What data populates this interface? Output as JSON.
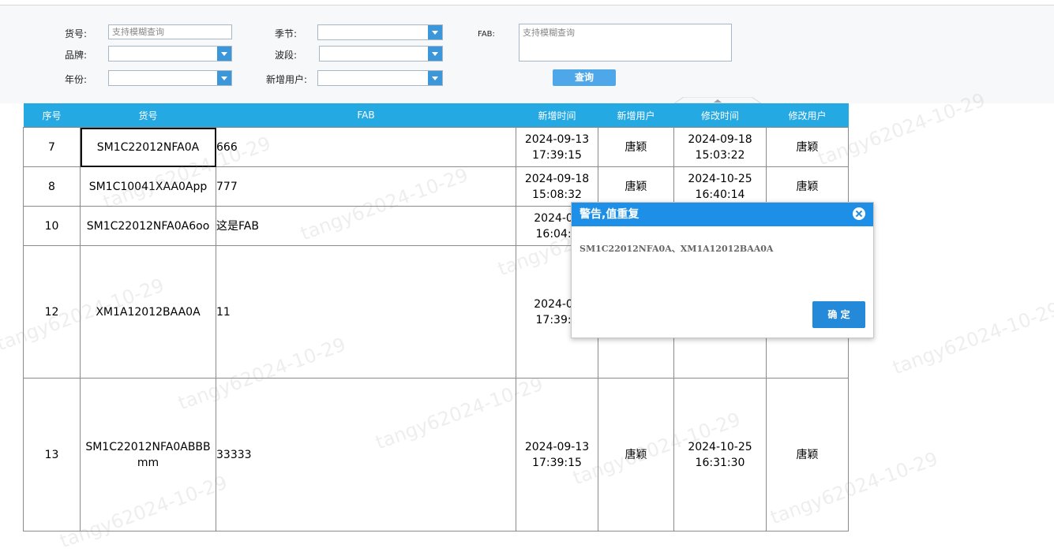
{
  "filters": {
    "huohao_label": "货号:",
    "huohao_placeholder": "支持模糊查询",
    "jijie_label": "季节:",
    "fab_label": "FAB:",
    "fab_placeholder": "支持模糊查询",
    "pinpai_label": "品牌:",
    "boduan_label": "波段:",
    "nianfen_label": "年份:",
    "xinzengyonghu_label": "新增用户:",
    "query_button": "查询"
  },
  "table": {
    "columns": [
      "序号",
      "货号",
      "FAB",
      "新增时间",
      "新增用户",
      "修改时间",
      "修改用户"
    ],
    "rows": [
      {
        "id": "7",
        "code": "SM1C22012NFA0A",
        "fab": "666",
        "add_time": "2024-09-13 17:39:15",
        "add_user": "唐颖",
        "mod_time": "2024-09-18 15:03:22",
        "mod_user": "唐颖"
      },
      {
        "id": "8",
        "code": "SM1C10041XAA0App",
        "fab": "777",
        "add_time": "2024-09-18 15:08:32",
        "add_user": "唐颖",
        "mod_time": "2024-10-25 16:40:14",
        "mod_user": "唐颖"
      },
      {
        "id": "10",
        "code": "SM1C22012NFA0A6oo",
        "fab": "这是FAB",
        "add_time": "2024-09 16:04:0",
        "add_user": "",
        "mod_time": "",
        "mod_user": ""
      },
      {
        "id": "12",
        "code": "XM1A12012BAA0A",
        "fab": "11",
        "add_time": "2024-09 17:39:1",
        "add_user": "",
        "mod_time": "",
        "mod_user": ""
      },
      {
        "id": "13",
        "code": "SM1C22012NFA0ABBB mm",
        "fab": "33333",
        "add_time": "2024-09-13 17:39:15",
        "add_user": "唐颖",
        "mod_time": "2024-10-25 16:31:30",
        "mod_user": "唐颖"
      }
    ]
  },
  "watermark": "tangy62024-10-29",
  "dialog": {
    "title": "警告,值重复",
    "message": "SM1C22012NFA0A、XM1A12012BAA0A",
    "ok_button": "确 定"
  },
  "colors": {
    "header": "#25a9e3",
    "dialog_header": "#1d8fe6",
    "button": "#4ea7e8"
  }
}
